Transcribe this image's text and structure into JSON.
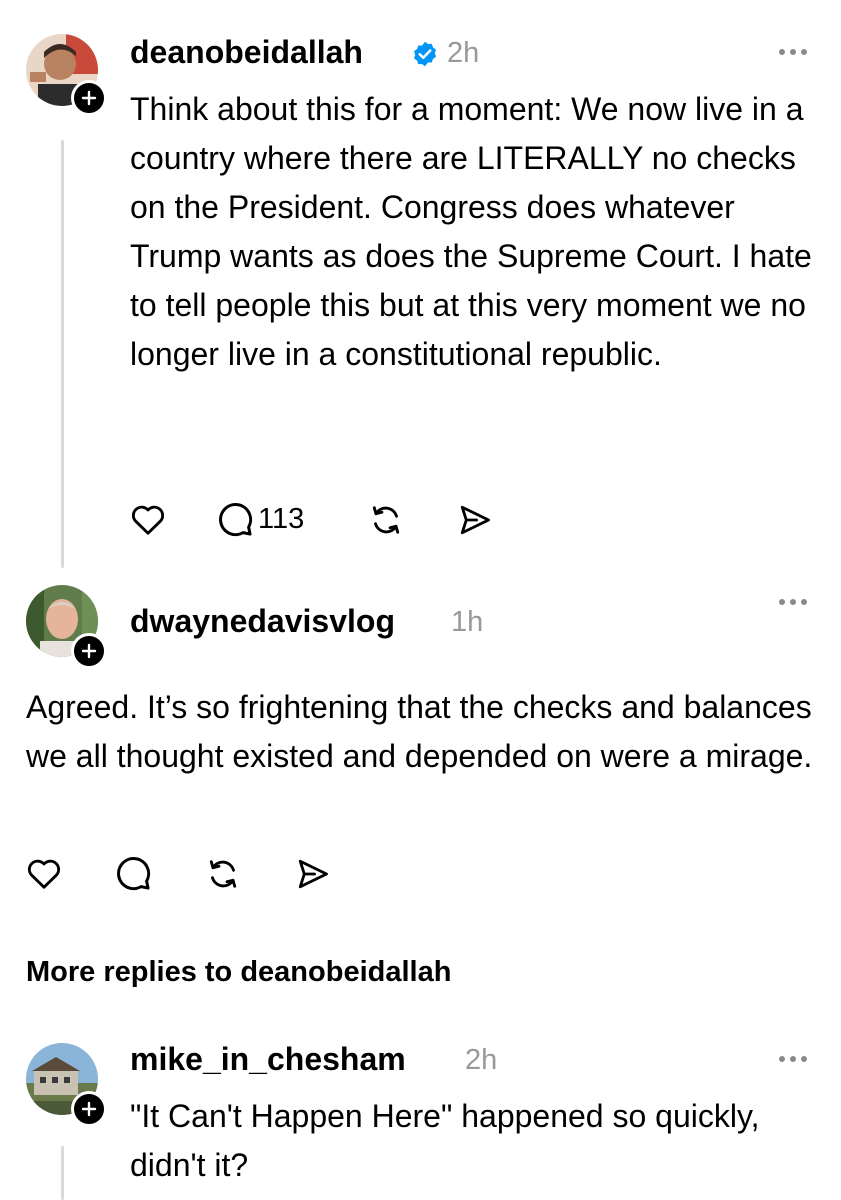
{
  "posts": [
    {
      "username": "deanobeidallah",
      "verified": true,
      "time": "2h",
      "text": "Think about this for a moment: We now live in a country where there are LITERALLY no checks on the President. Congress does whatever Trump wants as does the Supreme Court. I hate to tell people this but at this very moment we no longer live in a constitutional republic.",
      "reply_count": "113",
      "avatar_icon": "avatar-photo"
    },
    {
      "username": "dwaynedavisvlog",
      "verified": false,
      "time": "1h",
      "text": "Agreed. It’s so frightening that the checks and balances we all thought existed and depended on were a mirage.",
      "avatar_icon": "avatar-photo"
    },
    {
      "username": "mike_in_chesham",
      "verified": false,
      "time": "2h",
      "text": "\"It Can't Happen Here\" happened so quickly, didn't it?",
      "avatar_icon": "avatar-photo"
    }
  ],
  "more_replies_label": "More replies to deanobeidallah",
  "colors": {
    "text": "#000000",
    "muted": "#999999",
    "verified": "#0095f6",
    "thread_line": "#d9d9d9"
  },
  "icons": [
    "heart-icon",
    "comment-icon",
    "repost-icon",
    "share-icon",
    "more-icon",
    "verified-icon",
    "plus-icon"
  ]
}
